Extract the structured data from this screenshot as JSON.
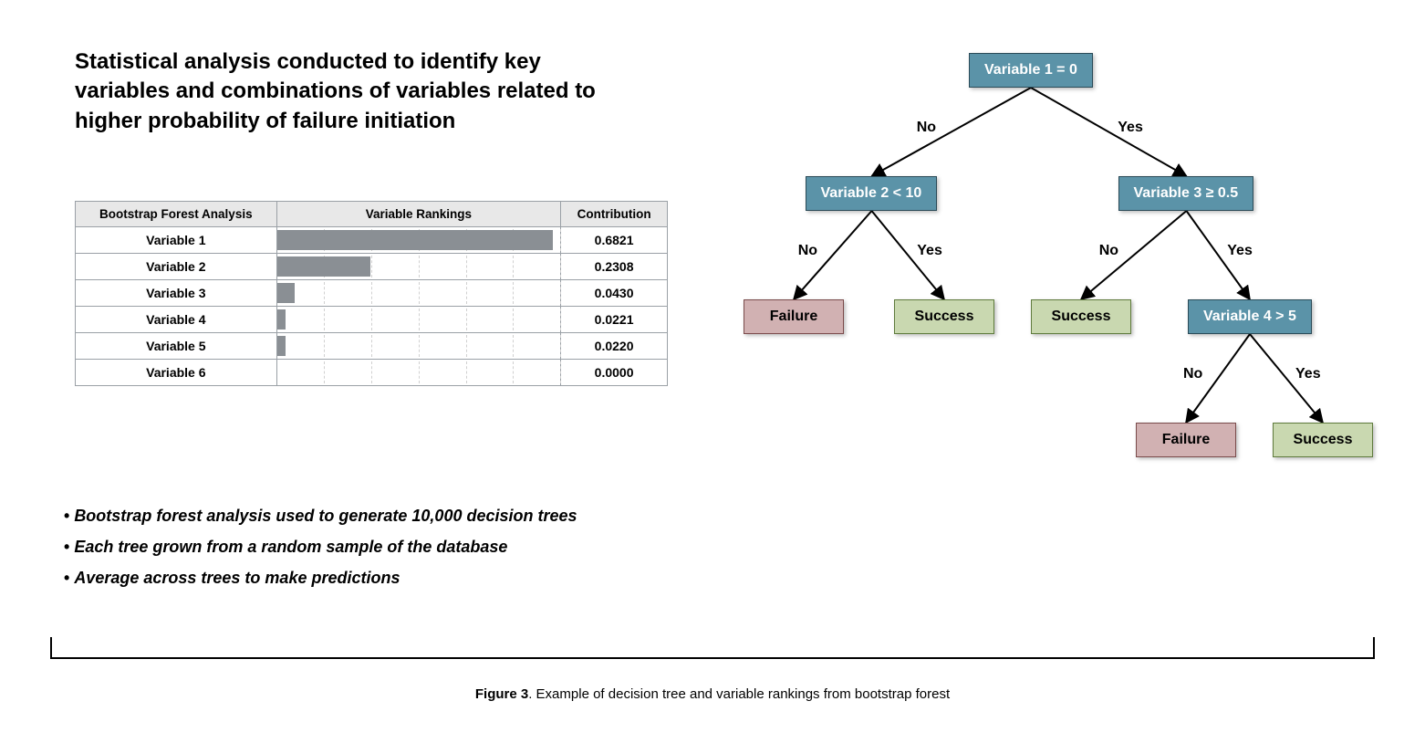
{
  "title": "Statistical analysis conducted to identify key variables and combinations of variables related to higher probability of failure initiation",
  "table": {
    "headers": {
      "name": "Bootstrap Forest Analysis",
      "rank": "Variable Rankings",
      "contrib": "Contribution"
    },
    "rows": [
      {
        "name": "Variable 1",
        "contribution": "0.6821"
      },
      {
        "name": "Variable 2",
        "contribution": "0.2308"
      },
      {
        "name": "Variable 3",
        "contribution": "0.0430"
      },
      {
        "name": "Variable 4",
        "contribution": "0.0221"
      },
      {
        "name": "Variable 5",
        "contribution": "0.0220"
      },
      {
        "name": "Variable 6",
        "contribution": "0.0000"
      }
    ]
  },
  "chart_data": {
    "type": "bar",
    "title": "Variable Rankings",
    "categories": [
      "Variable 1",
      "Variable 2",
      "Variable 3",
      "Variable 4",
      "Variable 5",
      "Variable 6"
    ],
    "values": [
      0.6821,
      0.2308,
      0.043,
      0.0221,
      0.022,
      0.0
    ],
    "xlabel": "Contribution",
    "ylabel": "",
    "xlim": [
      0,
      0.7
    ]
  },
  "bullets": [
    "Bootstrap forest analysis used to generate 10,000 decision trees",
    "Each tree grown from a random sample of the database",
    "Average across trees to make predictions"
  ],
  "caption": {
    "label": "Figure 3",
    "text": ". Example of decision tree and variable rankings from bootstrap forest"
  },
  "tree": {
    "edge_labels": {
      "no": "No",
      "yes": "Yes"
    },
    "nodes": {
      "root": {
        "type": "decision",
        "label": "Variable 1 = 0"
      },
      "n2": {
        "type": "decision",
        "label": "Variable 2 < 10"
      },
      "n3": {
        "type": "decision",
        "label": "Variable 3 ≥ 0.5"
      },
      "n4": {
        "type": "decision",
        "label": "Variable 4 > 5"
      },
      "fail1": {
        "type": "failure",
        "label": "Failure"
      },
      "succ1": {
        "type": "success",
        "label": "Success"
      },
      "succ2": {
        "type": "success",
        "label": "Success"
      },
      "fail2": {
        "type": "failure",
        "label": "Failure"
      },
      "succ3": {
        "type": "success",
        "label": "Success"
      }
    },
    "edges": [
      {
        "from": "root",
        "to": "n2",
        "label": "no"
      },
      {
        "from": "root",
        "to": "n3",
        "label": "yes"
      },
      {
        "from": "n2",
        "to": "fail1",
        "label": "no"
      },
      {
        "from": "n2",
        "to": "succ1",
        "label": "yes"
      },
      {
        "from": "n3",
        "to": "succ2",
        "label": "no"
      },
      {
        "from": "n3",
        "to": "n4",
        "label": "yes"
      },
      {
        "from": "n4",
        "to": "fail2",
        "label": "no"
      },
      {
        "from": "n4",
        "to": "succ3",
        "label": "yes"
      }
    ]
  },
  "colors": {
    "decision": "#5b93a8",
    "failure": "#d1b1b2",
    "success": "#c9d8b0",
    "bar": "#8a8f94"
  }
}
